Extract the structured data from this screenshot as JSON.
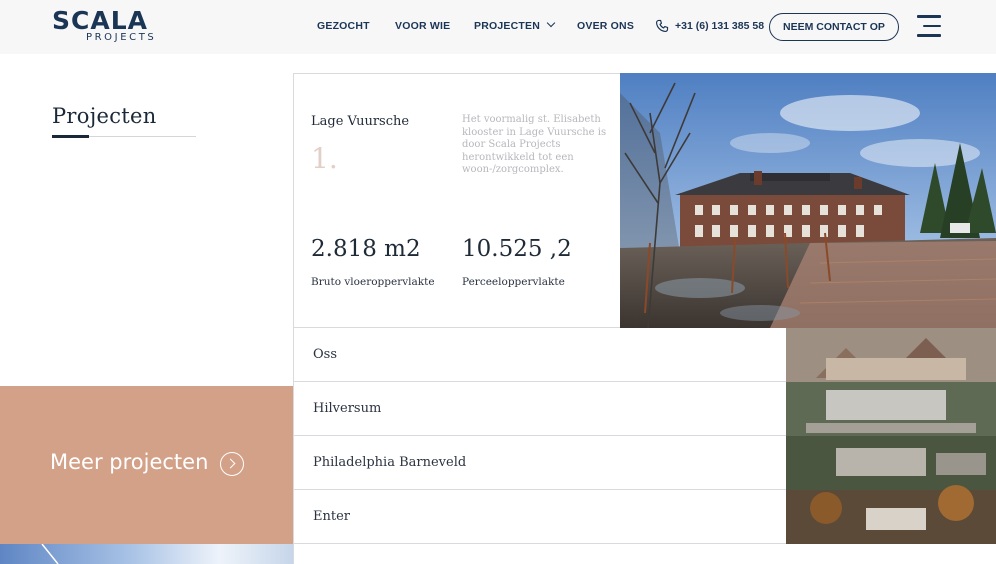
{
  "header": {
    "logo": {
      "main": "SCALA",
      "sub": "PROJECTS"
    },
    "nav": [
      {
        "label": "GEZOCHT"
      },
      {
        "label": "VOOR WIE"
      },
      {
        "label": "PROJECTEN",
        "has_dropdown": true
      },
      {
        "label": "OVER ONS"
      }
    ],
    "phone": "+31 (6) 131 385 58",
    "contact_label": "NEEM CONTACT OP"
  },
  "section": {
    "title": "Projecten"
  },
  "featured": {
    "name": "Lage Vuursche",
    "number": "1.",
    "description": "Het voormalig st. Elisabeth klooster in Lage Vuursche is door Scala Projects herontwikkeld tot een woon-/zorgcomplex.",
    "stats": [
      {
        "value": "2.818 m2",
        "label": "Bruto vloeroppervlakte"
      },
      {
        "value": "10.525 ,2",
        "label": "Perceeloppervlakte"
      }
    ]
  },
  "projects": [
    {
      "label": "Oss"
    },
    {
      "label": "Hilversum"
    },
    {
      "label": "Philadelphia Barneveld"
    },
    {
      "label": "Enter"
    }
  ],
  "more_projects_label": "Meer projecten",
  "colors": {
    "brand_navy": "#1b3555",
    "accent_terracotta": "#d3a088",
    "number_muted": "#e2cfc5"
  },
  "icons": [
    "phone-icon",
    "menu-icon",
    "chevron-down-icon",
    "arrow-right-circle-icon"
  ]
}
